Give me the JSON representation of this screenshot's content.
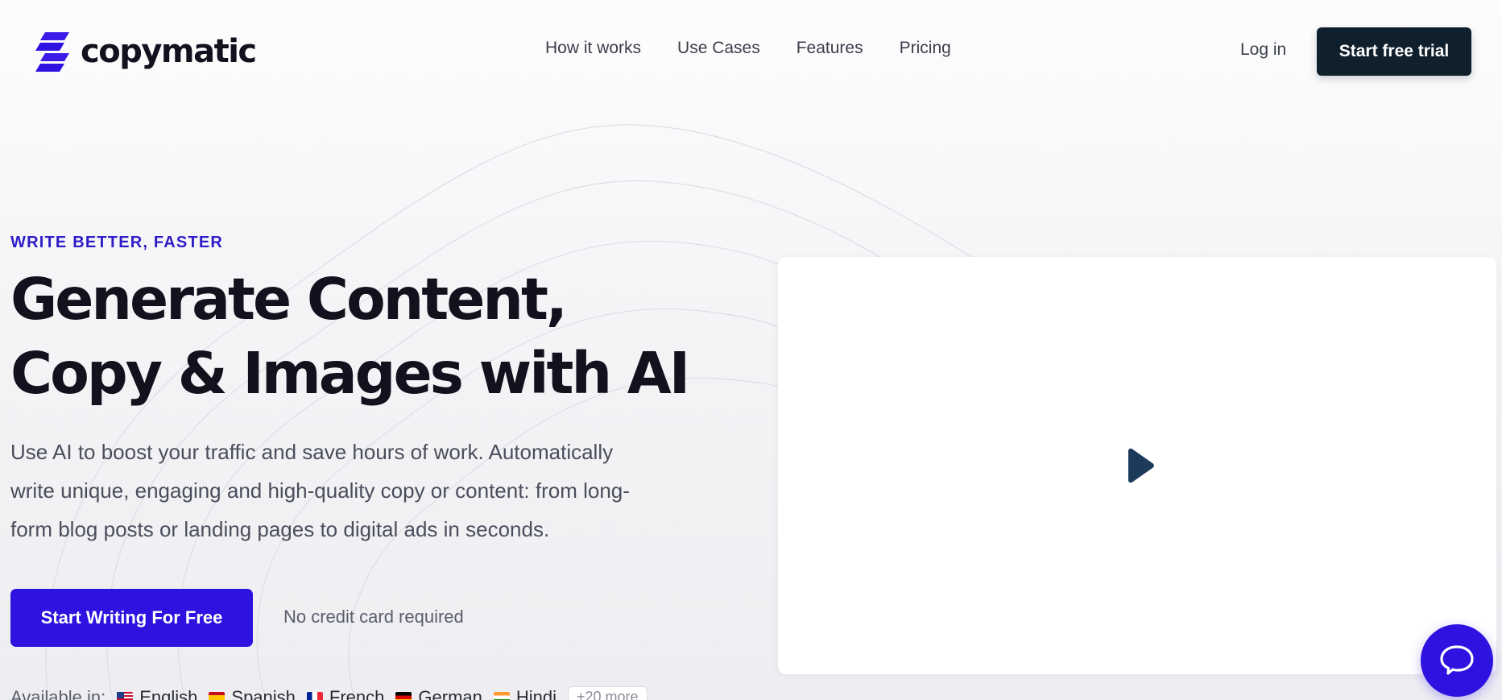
{
  "brand": {
    "name": "copymatic",
    "accent_color": "#2d12e0",
    "dark_color": "#0f1f2c",
    "logo_icon": "stacked-bars-logo-icon"
  },
  "nav": {
    "items": [
      {
        "label": "How it works"
      },
      {
        "label": "Use Cases"
      },
      {
        "label": "Features"
      },
      {
        "label": "Pricing"
      }
    ],
    "login_label": "Log in",
    "trial_label": "Start free trial"
  },
  "hero": {
    "eyebrow": "WRITE BETTER, FASTER",
    "headline_line1": "Generate Content,",
    "headline_line2": "Copy & Images with AI",
    "subtext": "Use AI to boost your traffic and save hours of work. Automatically write unique, engaging and high-quality copy or content: from long-form blog posts or landing pages to digital ads in seconds.",
    "cta_label": "Start Writing For Free",
    "no_cc_note": "No credit card required"
  },
  "languages": {
    "prefix": "Available in:",
    "items": [
      {
        "label": "English",
        "flag": "us-flag-icon"
      },
      {
        "label": "Spanish",
        "flag": "spain-flag-icon"
      },
      {
        "label": "French",
        "flag": "france-flag-icon"
      },
      {
        "label": "German",
        "flag": "germany-flag-icon"
      },
      {
        "label": "Hindi",
        "flag": "india-flag-icon"
      }
    ],
    "more_label": "+20 more"
  },
  "video": {
    "play_icon": "play-icon"
  },
  "chat": {
    "icon": "chat-bubble-icon"
  }
}
